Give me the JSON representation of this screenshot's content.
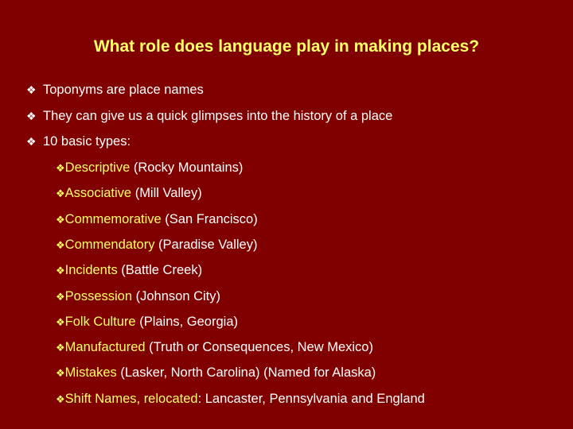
{
  "title": "What role does language play in making places?",
  "bullet_icon": "❖",
  "bullets": [
    "Toponyms are place names",
    "They can give us a quick glimpses into the history of a place",
    "10 basic types:"
  ],
  "types": [
    {
      "term": "Descriptive",
      "example": " (Rocky Mountains)"
    },
    {
      "term": "Associative",
      "example": " (Mill Valley)"
    },
    {
      "term": "Commemorative",
      "example": " (San Francisco)"
    },
    {
      "term": "Commendatory",
      "example": " (Paradise Valley)"
    },
    {
      "term": "Incidents",
      "example": " (Battle Creek)"
    },
    {
      "term": "Possession",
      "example": " (Johnson City)"
    },
    {
      "term": "Folk Culture",
      "example": " (Plains, Georgia)"
    },
    {
      "term": "Manufactured",
      "example": " (Truth or Consequences, New Mexico)"
    },
    {
      "term": "Mistakes",
      "example": " (Lasker, North Carolina) (Named for Alaska)"
    },
    {
      "term": "Shift Names, relocated",
      "example": ": Lancaster, Pennsylvania and England"
    }
  ]
}
